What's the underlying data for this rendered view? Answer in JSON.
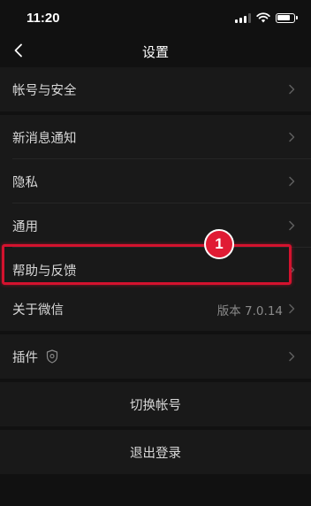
{
  "status_bar": {
    "time": "11:20",
    "battery_level": 0.8
  },
  "nav": {
    "title": "设置",
    "back_icon": "chevron-left-icon"
  },
  "settings": {
    "account_security": "帐号与安全",
    "new_message_notify": "新消息通知",
    "privacy": "隐私",
    "general": "通用",
    "help_feedback": "帮助与反馈",
    "about": "关于微信",
    "about_version": "版本 7.0.14",
    "plugins": "插件",
    "plugins_icon": "shield-icon",
    "switch_account": "切换帐号",
    "logout": "退出登录"
  },
  "annotation": {
    "step_number": "1",
    "color": "#d4122e"
  }
}
